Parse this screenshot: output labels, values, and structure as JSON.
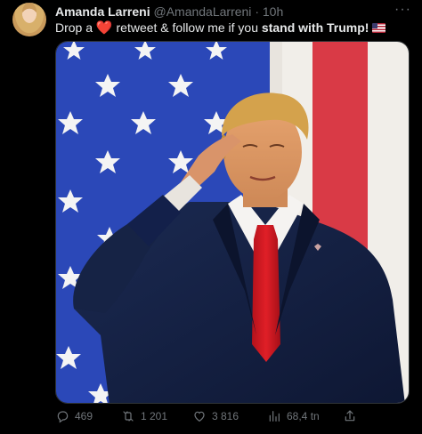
{
  "author": {
    "name": "Amanda Larreni",
    "handle": "@AmandaLarreni",
    "separator": "·",
    "time": "10h"
  },
  "tweet": {
    "text_before_heart": "Drop a ",
    "heart_emoji": "❤️",
    "text_middle": " retweet & follow me if you ",
    "text_bold": "stand with Trump!",
    "flag_emoji": "us-flag-emoji"
  },
  "more_label": "···",
  "media": {
    "icon": "photo-saluting-man-flag-background"
  },
  "actions": {
    "replies": "469",
    "retweets": "1 201",
    "likes": "3 816",
    "views": "68,4 tn"
  },
  "icons": {
    "reply": "reply-icon",
    "retweet": "retweet-icon",
    "like": "heart-icon",
    "views": "views-icon",
    "share": "share-icon"
  },
  "colors": {
    "background": "#000000",
    "text": "#e7e9ea",
    "muted": "#71767b",
    "heart": "#e0245e"
  }
}
